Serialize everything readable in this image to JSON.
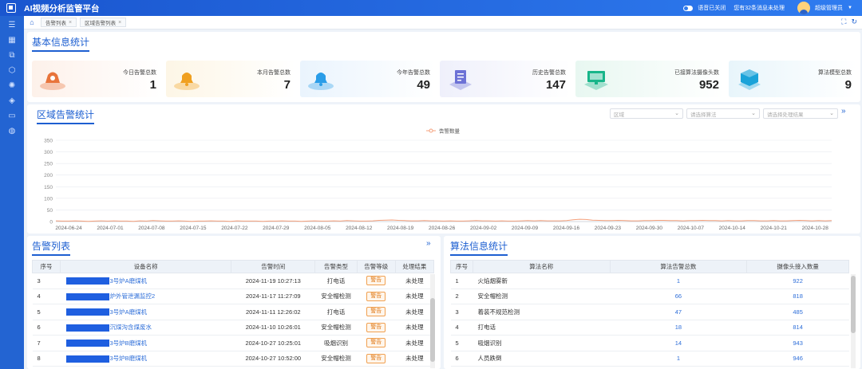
{
  "app": {
    "title": "AI视频分析监管平台",
    "voice_label": "语音已关闭",
    "message_notice": "您有32条消息未处理",
    "user_name": "超级管理员"
  },
  "sidebar": {
    "icons": [
      "menu-icon",
      "dashboard-icon",
      "org-icon",
      "location-icon",
      "settings-icon",
      "layers-icon",
      "monitor-icon",
      "globe-icon"
    ]
  },
  "tabs": [
    {
      "label": "告警列表"
    },
    {
      "label": "区域告警列表"
    }
  ],
  "basic": {
    "title": "基本信息统计",
    "cards": [
      {
        "label": "今日告警总数",
        "value": "1",
        "icon": "alarm-bell-icon",
        "color": "#e8743b",
        "bg": "#fdf1ea"
      },
      {
        "label": "本月告警总数",
        "value": "7",
        "icon": "bell-icon",
        "color": "#f0a020",
        "bg": "#fdf6e6"
      },
      {
        "label": "今年告警总数",
        "value": "49",
        "icon": "bell-icon",
        "color": "#2a9de8",
        "bg": "#eaf4fd"
      },
      {
        "label": "历史告警总数",
        "value": "147",
        "icon": "document-icon",
        "color": "#6d72d6",
        "bg": "#eff0fb"
      },
      {
        "label": "已接算法摄像头数",
        "value": "952",
        "icon": "monitor-icon",
        "color": "#18b58a",
        "bg": "#e8f7f1"
      },
      {
        "label": "算法模型总数",
        "value": "9",
        "icon": "cube-icon",
        "color": "#1aa3d9",
        "bg": "#e8f5fb"
      }
    ]
  },
  "region": {
    "title": "区域告警统计",
    "filters": {
      "region": "区域",
      "algorithm": "请选择算法",
      "result": "请选择处理结果"
    }
  },
  "chart_data": {
    "type": "line",
    "series": [
      {
        "name": "告警数量",
        "color": "#f4a07c",
        "values": [
          3,
          2,
          2,
          3,
          2,
          1,
          2,
          3,
          2,
          3,
          2,
          2,
          1,
          3,
          2,
          4,
          3,
          2,
          2,
          3,
          2,
          1,
          2,
          2,
          3,
          2,
          2,
          1,
          3,
          2,
          2,
          2,
          1,
          2,
          2,
          3,
          2,
          2,
          1,
          2,
          3,
          2,
          2,
          3,
          2,
          4,
          3,
          2,
          2,
          3,
          5,
          6,
          7,
          5,
          4,
          3,
          3,
          4,
          3,
          3,
          2,
          3,
          2,
          2,
          3,
          4,
          3,
          3,
          2,
          3,
          2,
          2,
          3,
          4,
          3,
          4,
          3,
          3,
          3,
          4,
          8,
          10,
          9,
          6,
          5,
          4,
          4,
          5,
          4,
          3,
          3,
          4,
          4,
          5,
          5,
          4,
          4,
          3,
          4,
          4,
          5,
          4,
          4,
          3,
          4,
          3,
          3,
          4,
          4,
          3,
          3,
          4,
          3,
          3,
          4,
          5,
          4,
          3,
          4,
          3,
          4
        ]
      }
    ],
    "x_ticks": [
      "2024-06-24",
      "2024-07-01",
      "2024-07-08",
      "2024-07-15",
      "2024-07-22",
      "2024-07-29",
      "2024-08-05",
      "2024-08-12",
      "2024-08-19",
      "2024-08-26",
      "2024-09-02",
      "2024-09-09",
      "2024-09-16",
      "2024-09-23",
      "2024-09-30",
      "2024-10-07",
      "2024-10-14",
      "2024-10-21",
      "2024-10-28"
    ],
    "y_ticks": [
      "0",
      "50",
      "100",
      "150",
      "200",
      "250",
      "300",
      "350"
    ],
    "ylim": [
      0,
      350
    ],
    "legend": "top-center",
    "grid": true
  },
  "alarm_list": {
    "title": "告警列表",
    "columns": [
      "序号",
      "设备名称",
      "告警时间",
      "告警类型",
      "告警等级",
      "处理结果"
    ],
    "rows": [
      {
        "no": "3",
        "device": "3号炉A磨煤机",
        "time": "2024-11-19 10:27:13",
        "type": "打电话",
        "level": "警告",
        "result": "未处理"
      },
      {
        "no": "4",
        "device": "炉外管泄漏监控2",
        "time": "2024-11-17 11:27:09",
        "type": "安全帽检测",
        "level": "警告",
        "result": "未处理"
      },
      {
        "no": "5",
        "device": "3号炉A磨煤机",
        "time": "2024-11-11 12:26:02",
        "type": "打电话",
        "level": "警告",
        "result": "未处理"
      },
      {
        "no": "6",
        "device": "沉煤沟含煤废水",
        "time": "2024-11-10 10:26:01",
        "type": "安全帽检测",
        "level": "警告",
        "result": "未处理"
      },
      {
        "no": "7",
        "device": "3号炉B磨煤机",
        "time": "2024-10-27 10:25:01",
        "type": "吸烟识别",
        "level": "警告",
        "result": "未处理"
      },
      {
        "no": "8",
        "device": "3号炉B磨煤机",
        "time": "2024-10-27 10:52:00",
        "type": "安全帽检测",
        "level": "警告",
        "result": "未处理"
      }
    ]
  },
  "algo_stats": {
    "title": "算法信息统计",
    "columns": [
      "序号",
      "算法名称",
      "算法告警总数",
      "摄像头接入数量"
    ],
    "rows": [
      {
        "no": "1",
        "name": "火焰烟雾新",
        "alarms": "1",
        "cameras": "922"
      },
      {
        "no": "2",
        "name": "安全帽检测",
        "alarms": "66",
        "cameras": "818"
      },
      {
        "no": "3",
        "name": "着装不规范检测",
        "alarms": "47",
        "cameras": "485"
      },
      {
        "no": "4",
        "name": "打电话",
        "alarms": "18",
        "cameras": "814"
      },
      {
        "no": "5",
        "name": "吸烟识别",
        "alarms": "14",
        "cameras": "943"
      },
      {
        "no": "6",
        "name": "人员跌倒",
        "alarms": "1",
        "cameras": "946"
      }
    ]
  }
}
